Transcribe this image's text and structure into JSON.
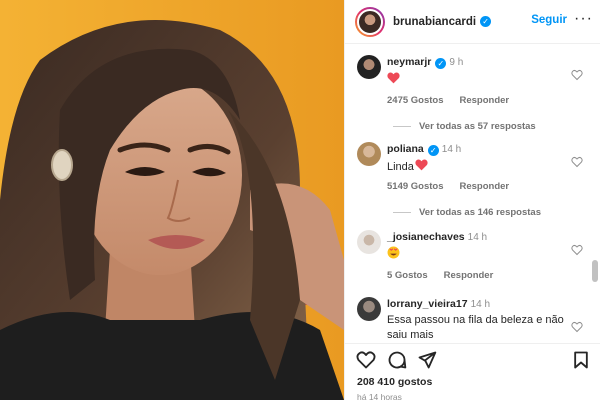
{
  "post": {
    "image_alt": "photo-of-woman"
  },
  "header": {
    "username": "brunabiancardi",
    "verified_glyph": "✓",
    "follow_label": "Seguir",
    "more_glyph": "···"
  },
  "comments": [
    {
      "user": "neymarjr",
      "verified": true,
      "time": "9 h",
      "text": "",
      "emoji": "heart",
      "likes": "2475 Gostos",
      "reply": "Responder",
      "view_replies": "Ver todas as 57 respostas"
    },
    {
      "user": "poliana",
      "verified": true,
      "time": "14 h",
      "text": "Linda",
      "emoji": "heart",
      "likes": "5149 Gostos",
      "reply": "Responder",
      "view_replies": "Ver todas as 146 respostas"
    },
    {
      "user": "_josianechaves",
      "verified": false,
      "time": "14 h",
      "text": "",
      "emoji": "heart-eyes",
      "likes": "5 Gostos",
      "reply": "Responder",
      "view_replies": ""
    },
    {
      "user": "lorrany_vieira17",
      "verified": false,
      "time": "14 h",
      "text": "Essa passou na fila da beleza e não saiu mais",
      "emoji": "",
      "likes": "",
      "reply": "",
      "view_replies": ""
    }
  ],
  "actions": {
    "likes_count": "208 410 gostos",
    "time_ago": "há 14 horas"
  },
  "colors": {
    "accent": "#0095f6",
    "heart": "#ed4956",
    "background_photo": "#f2a72d"
  }
}
